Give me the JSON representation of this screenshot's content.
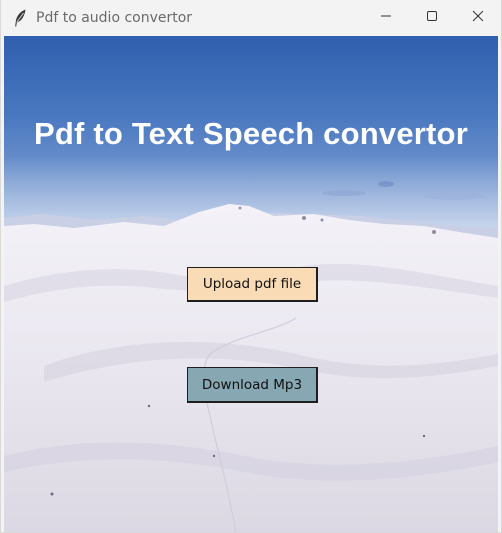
{
  "window": {
    "title": "Pdf to audio convertor",
    "app_icon": "feather-icon",
    "controls": [
      "minimize-icon",
      "maximize-icon",
      "close-icon"
    ]
  },
  "main": {
    "heading": "Pdf to Text Speech convertor",
    "background": "snowy-mountain-photo",
    "upload_button": {
      "label": "Upload pdf file",
      "color": "#f9dcb6"
    },
    "download_button": {
      "label": "Download Mp3",
      "color": "#87a8b2"
    }
  }
}
